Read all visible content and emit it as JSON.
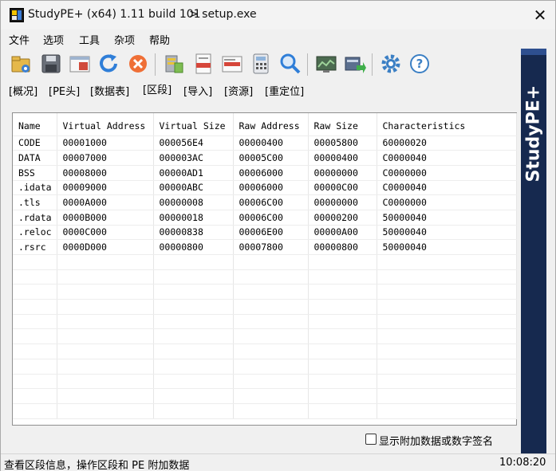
{
  "window": {
    "title": "StudyPE+ (x64) 1.11 build 101",
    "file": "> setup.exe",
    "close_label": "✕"
  },
  "menu": [
    "文件",
    "选项",
    "工具",
    "杂项",
    "帮助"
  ],
  "toolbar": [
    {
      "icon": "open-file-icon"
    },
    {
      "icon": "save-icon"
    },
    {
      "icon": "window-icon"
    },
    {
      "icon": "refresh-icon"
    },
    {
      "icon": "close-circle-icon"
    },
    {
      "icon": "database-icon"
    },
    {
      "icon": "asm-file-icon"
    },
    {
      "icon": "text-file-icon"
    },
    {
      "icon": "calculator-icon"
    },
    {
      "icon": "magnifier-icon"
    },
    {
      "icon": "monitor-icon"
    },
    {
      "icon": "export-icon"
    },
    {
      "icon": "gear-icon"
    },
    {
      "icon": "help-icon"
    }
  ],
  "tabs": [
    "[概况]",
    "[PE头]",
    "[数据表]",
    "[区段]",
    "[导入]",
    "[资源]",
    "[重定位]"
  ],
  "active_tab": "[区段]",
  "sections_table": {
    "columns": [
      "Name",
      "Virtual Address",
      "Virtual Size",
      "Raw Address",
      "Raw Size",
      "Characteristics"
    ],
    "rows": [
      [
        "CODE",
        "00001000",
        "000056E4",
        "00000400",
        "00005800",
        "60000020"
      ],
      [
        "DATA",
        "00007000",
        "000003AC",
        "00005C00",
        "00000400",
        "C0000040"
      ],
      [
        "BSS",
        "00008000",
        "00000AD1",
        "00006000",
        "00000000",
        "C0000000"
      ],
      [
        ".idata",
        "00009000",
        "00000ABC",
        "00006000",
        "00000C00",
        "C0000040"
      ],
      [
        ".tls",
        "0000A000",
        "00000008",
        "00006C00",
        "00000000",
        "C0000000"
      ],
      [
        ".rdata",
        "0000B000",
        "00000018",
        "00006C00",
        "00000200",
        "50000040"
      ],
      [
        ".reloc",
        "0000C000",
        "00000838",
        "00006E00",
        "00000A00",
        "50000040"
      ],
      [
        ".rsrc",
        "0000D000",
        "00000800",
        "00007800",
        "00000800",
        "50000040"
      ]
    ]
  },
  "sidebar": {
    "brand": "StudyPE+"
  },
  "overlay_checkbox": {
    "label": "显示附加数据或数字签名",
    "checked": false
  },
  "status": {
    "text": "查看区段信息，操作区段和 PE 附加数据",
    "time": "10:08:20"
  }
}
